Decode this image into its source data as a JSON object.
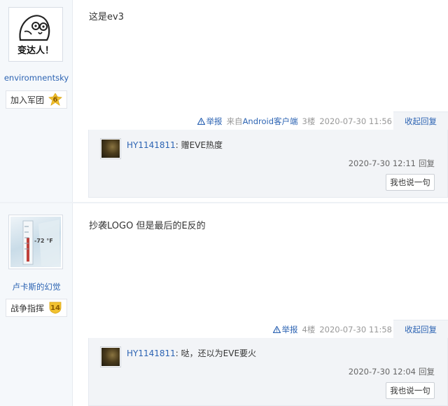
{
  "posts": [
    {
      "author": "enviromnentsky",
      "avatar_caption": "变达人！",
      "badge_label": "加入军团",
      "badge_level": "6",
      "content": "这是ev3",
      "report": "举报",
      "from_prefix": "来自",
      "client": "Android客户端",
      "floor": "3楼",
      "time": "2020-07-30 11:56",
      "collapse": "收起回复",
      "reply": {
        "name": "HY1141811",
        "separator": ":",
        "text": "赠EVE热度",
        "time": "2020-7-30 12:11",
        "reply_label": "回复",
        "say_button": "我也说一句"
      }
    },
    {
      "author": "卢卡斯的幻觉",
      "avatar_caption": "-72 °F",
      "badge_label": "战争指挥",
      "badge_level": "14",
      "content": "抄袭LOGO 但是最后的E反的",
      "report": "举报",
      "floor": "4楼",
      "time": "2020-07-30 11:58",
      "collapse": "收起回复",
      "reply": {
        "name": "HY1141811",
        "separator": ":",
        "text": "哒，还以为EVE要火",
        "time": "2020-7-30 12:04",
        "reply_label": "回复",
        "say_button": "我也说一句"
      }
    }
  ],
  "colors": {
    "link": "#2d64b3",
    "sidebar_bg": "#f5f8fb",
    "reply_bg": "#f2f4f7",
    "badge_gold": "#f2c230"
  },
  "icons": {
    "report": "warning-triangle-icon",
    "level": "level-badge-icon"
  }
}
